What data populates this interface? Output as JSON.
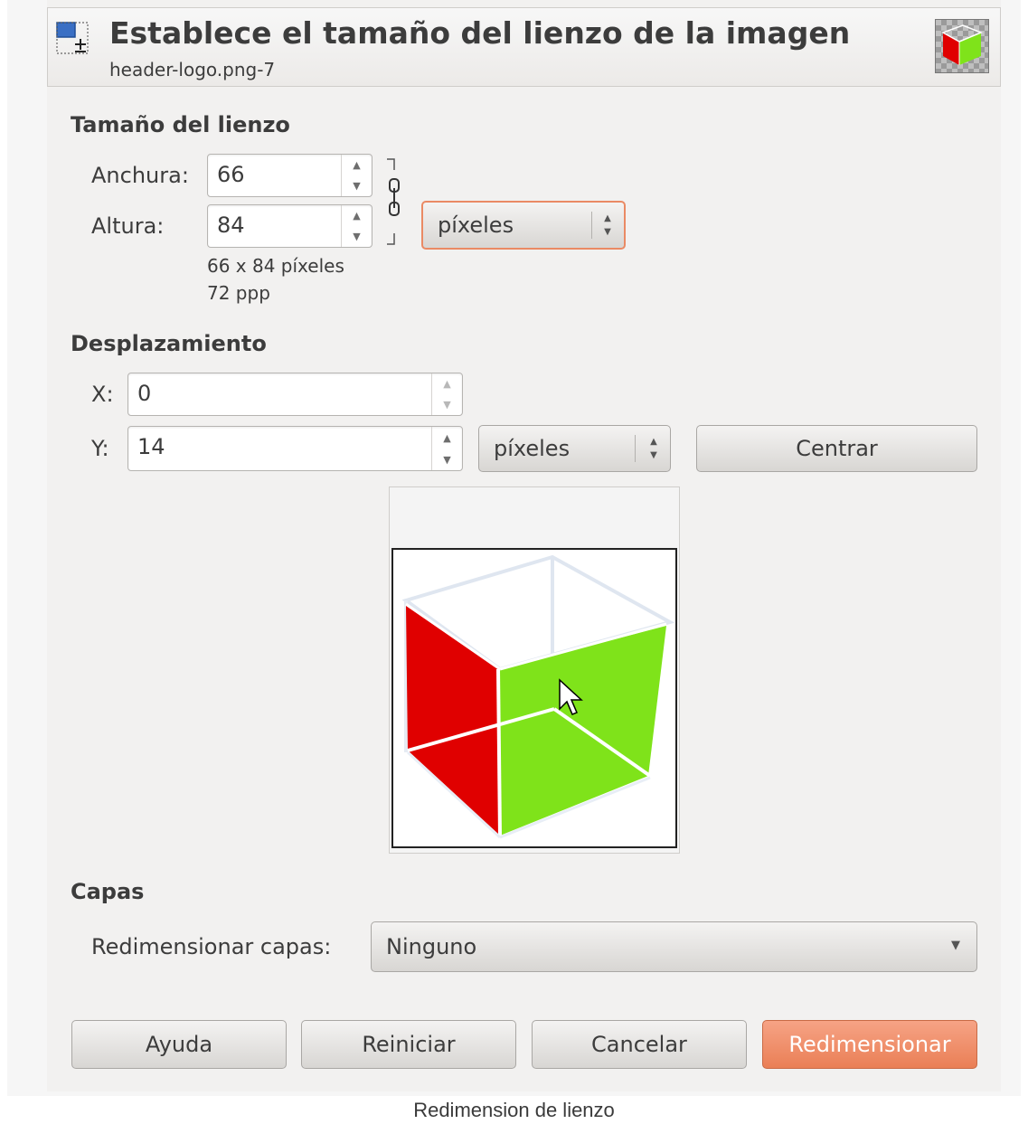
{
  "header": {
    "title": "Establece el tamaño del lienzo de la imagen",
    "subtitle": "header-logo.png-7"
  },
  "canvas_size": {
    "section_title": "Tamaño del lienzo",
    "width_label": "Anchura:",
    "width_value": "66",
    "height_label": "Altura:",
    "height_value": "84",
    "unit": "píxeles",
    "info_size": "66 x 84 píxeles",
    "info_dpi": "72 ppp"
  },
  "offset": {
    "section_title": "Desplazamiento",
    "x_label": "X:",
    "x_value": "0",
    "y_label": "Y:",
    "y_value": "14",
    "unit": "píxeles",
    "center_button": "Centrar"
  },
  "layers": {
    "section_title": "Capas",
    "resize_label": "Redimensionar capas:",
    "resize_value": "Ninguno"
  },
  "buttons": {
    "help": "Ayuda",
    "reset": "Reiniciar",
    "cancel": "Cancelar",
    "resize": "Redimensionar"
  },
  "caption": "Redimension de lienzo",
  "colors": {
    "accent": "#ea7f56",
    "cube_red": "#e00000",
    "cube_green": "#7fe31a"
  }
}
